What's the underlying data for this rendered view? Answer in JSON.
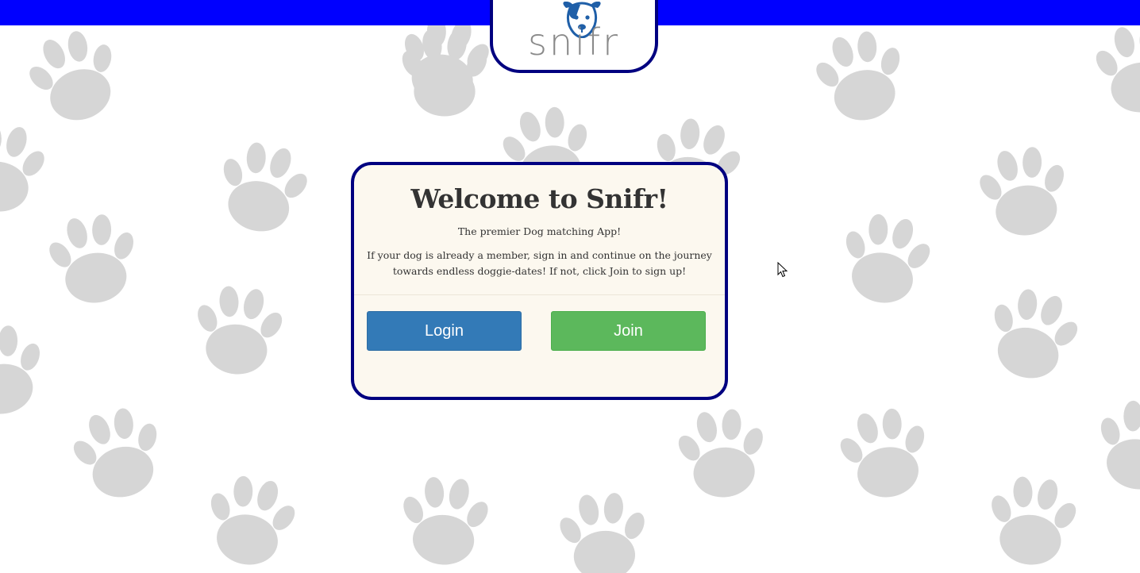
{
  "app": {
    "logo_text": "snifr"
  },
  "card": {
    "title": "Welcome to Snifr!",
    "tagline": "The premier Dog matching App!",
    "description": "If your dog is already a member, sign in and continue on the journey towards endless doggie-dates! If not, click Join to sign up!"
  },
  "actions": {
    "login_label": "Login",
    "join_label": "Join"
  },
  "colors": {
    "top_bar": "#0000ff",
    "card_border": "#000080",
    "card_background": "#fcf8ef",
    "login_button": "#337ab7",
    "join_button": "#5cb85c",
    "paw_print": "#d6d6d6"
  },
  "icons": {
    "logo": "dog-face-icon",
    "background": "paw-print-icon",
    "pointer": "mouse-cursor-icon"
  }
}
